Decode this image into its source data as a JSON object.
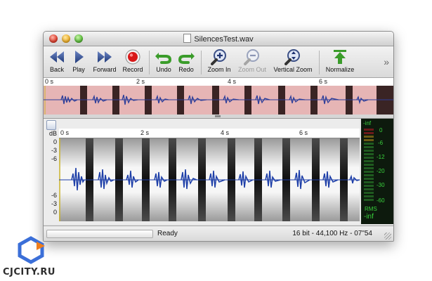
{
  "window": {
    "title": "SilencesTest.wav"
  },
  "toolbar": {
    "buttons": [
      {
        "label": "Back",
        "icon": "rewind-icon",
        "enabled": true
      },
      {
        "label": "Play",
        "icon": "play-icon",
        "enabled": true
      },
      {
        "label": "Forward",
        "icon": "fast-forward-icon",
        "enabled": true
      },
      {
        "label": "Record",
        "icon": "record-icon",
        "enabled": true
      },
      {
        "label": "Undo",
        "icon": "undo-arrow-icon",
        "enabled": true
      },
      {
        "label": "Redo",
        "icon": "redo-arrow-icon",
        "enabled": true
      },
      {
        "label": "Zoom In",
        "icon": "magnifier-plus-icon",
        "enabled": true
      },
      {
        "label": "Zoom Out",
        "icon": "magnifier-minus-icon",
        "enabled": false
      },
      {
        "label": "Vertical Zoom",
        "icon": "magnifier-vertical-icon",
        "enabled": true
      },
      {
        "label": "Normalize",
        "icon": "normalize-arrow-icon",
        "enabled": true
      }
    ],
    "overflow": "»"
  },
  "overview_ruler": {
    "ticks": [
      "0 s",
      "2 s",
      "4 s",
      "6 s"
    ]
  },
  "main_ruler": {
    "ticks": [
      "0 s",
      "2 s",
      "4 s",
      "6 s"
    ]
  },
  "db_scale": {
    "unit": "dB",
    "labels_top": [
      "0",
      "-3",
      "-6"
    ],
    "labels_bottom": [
      "-6",
      "-3",
      "0"
    ]
  },
  "meter": {
    "top_label": "-inf",
    "scale": [
      "0",
      "-6",
      "-12",
      "-20",
      "-30",
      "-60"
    ],
    "mode_label": "RMS",
    "value_label": "-inf"
  },
  "status": {
    "state": "Ready",
    "info": "16 bit - 44,100 Hz - 07\"54"
  },
  "watermark": {
    "brand": "CJCITY.RU"
  },
  "colors": {
    "waveform": "#1e3fa8",
    "overview_bg": "#e6b5b5",
    "meter_text": "#39d13c"
  }
}
